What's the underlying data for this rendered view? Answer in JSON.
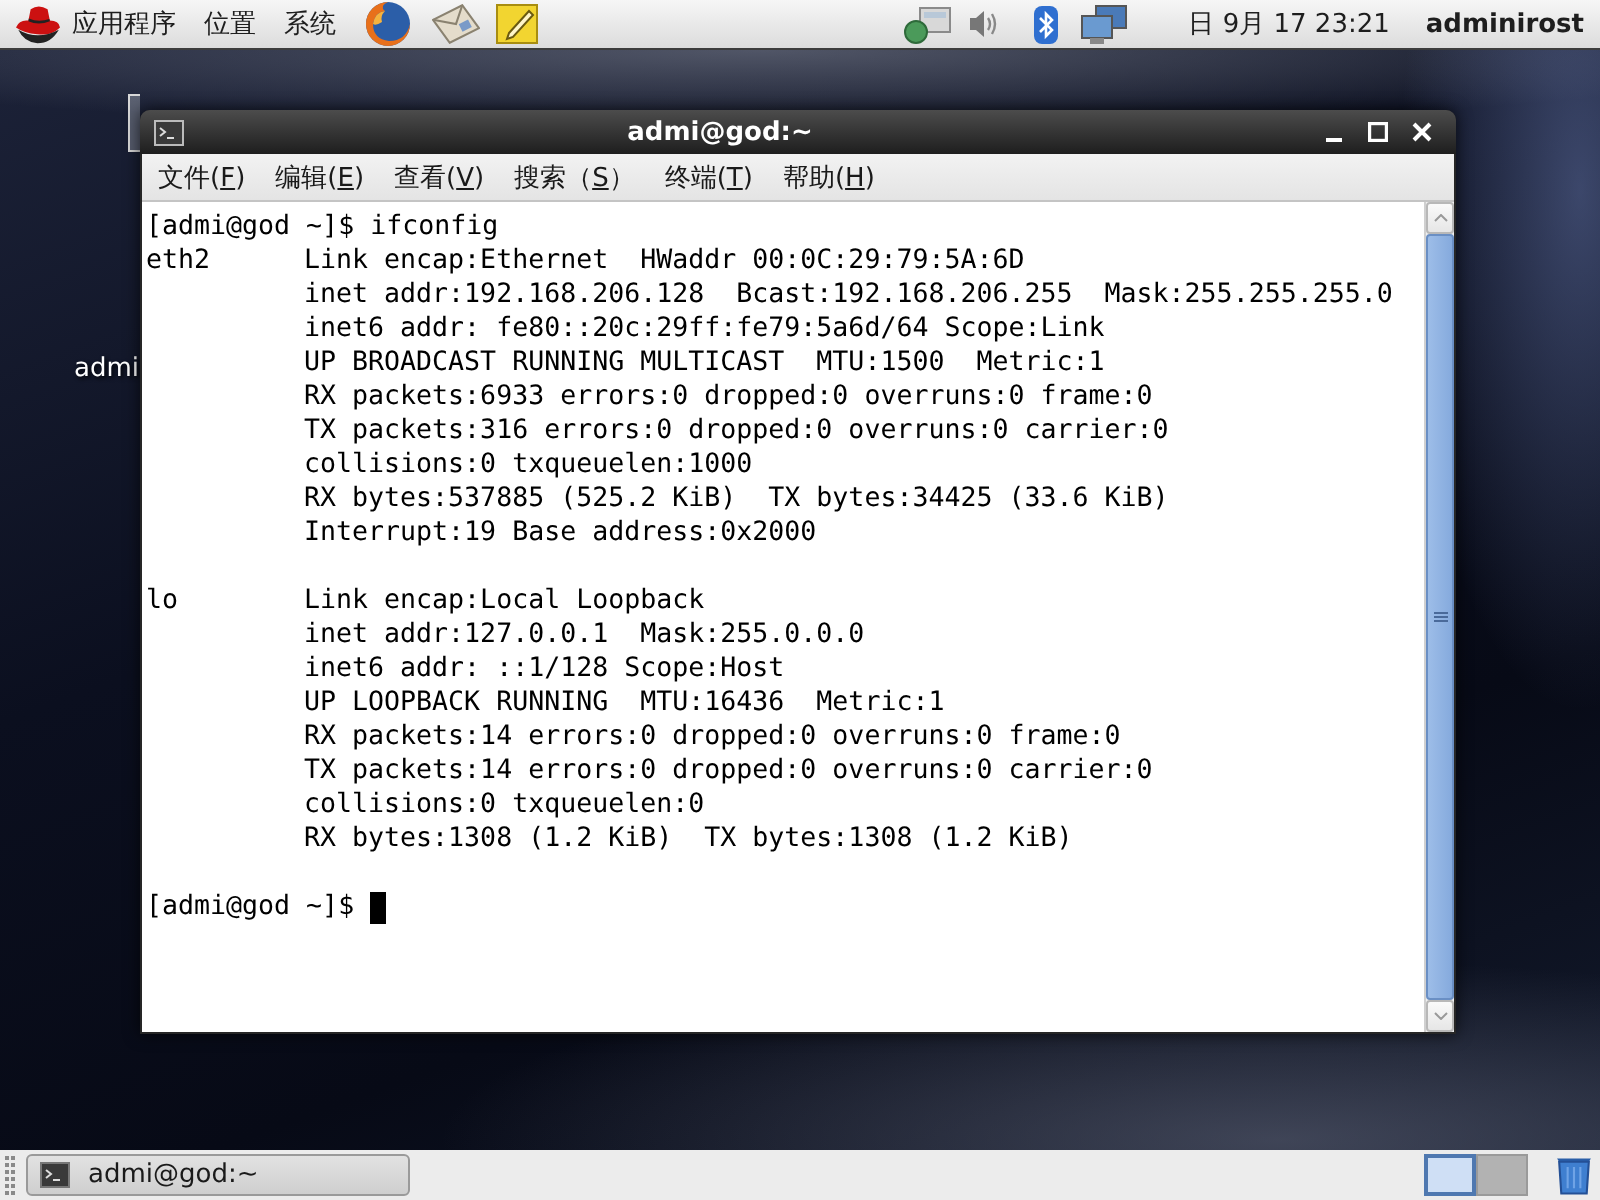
{
  "top_panel": {
    "menus": [
      {
        "label": "应用程序"
      },
      {
        "label": "位置"
      },
      {
        "label": "系统"
      }
    ],
    "clock": "日 9月 17 23:21",
    "user": "adminirost"
  },
  "desktop": {
    "icon_label": "admi"
  },
  "terminal": {
    "title": "admi@god:~",
    "menu": [
      {
        "text": "文件(",
        "key": "F",
        "end": ")"
      },
      {
        "text": "编辑(",
        "key": "E",
        "end": ")"
      },
      {
        "text": "查看(",
        "key": "V",
        "end": ")"
      },
      {
        "text": "搜索（",
        "key": "S",
        "end": "）"
      },
      {
        "text": "终端(",
        "key": "T",
        "end": ")"
      },
      {
        "text": "帮助(",
        "key": "H",
        "end": ")"
      }
    ],
    "command_line": "[admi@god ~]$ ifconfig",
    "interfaces": [
      {
        "name": "eth2",
        "lines": [
          "Link encap:Ethernet  HWaddr 00:0C:29:79:5A:6D",
          "inet addr:192.168.206.128  Bcast:192.168.206.255  Mask:255.255.255.0",
          "inet6 addr: fe80::20c:29ff:fe79:5a6d/64 Scope:Link",
          "UP BROADCAST RUNNING MULTICAST  MTU:1500  Metric:1",
          "RX packets:6933 errors:0 dropped:0 overruns:0 frame:0",
          "TX packets:316 errors:0 dropped:0 overruns:0 carrier:0",
          "collisions:0 txqueuelen:1000",
          "RX bytes:537885 (525.2 KiB)  TX bytes:34425 (33.6 KiB)",
          "Interrupt:19 Base address:0x2000"
        ]
      },
      {
        "name": "lo",
        "lines": [
          "Link encap:Local Loopback",
          "inet addr:127.0.0.1  Mask:255.0.0.0",
          "inet6 addr: ::1/128 Scope:Host",
          "UP LOOPBACK RUNNING  MTU:16436  Metric:1",
          "RX packets:14 errors:0 dropped:0 overruns:0 frame:0",
          "TX packets:14 errors:0 dropped:0 overruns:0 carrier:0",
          "collisions:0 txqueuelen:0",
          "RX bytes:1308 (1.2 KiB)  TX bytes:1308 (1.2 KiB)"
        ]
      }
    ],
    "prompt": "[admi@god ~]$"
  },
  "taskbar": {
    "task": "admi@god:~",
    "workspaces": [
      {
        "selected": true
      },
      {
        "selected": false
      }
    ]
  }
}
